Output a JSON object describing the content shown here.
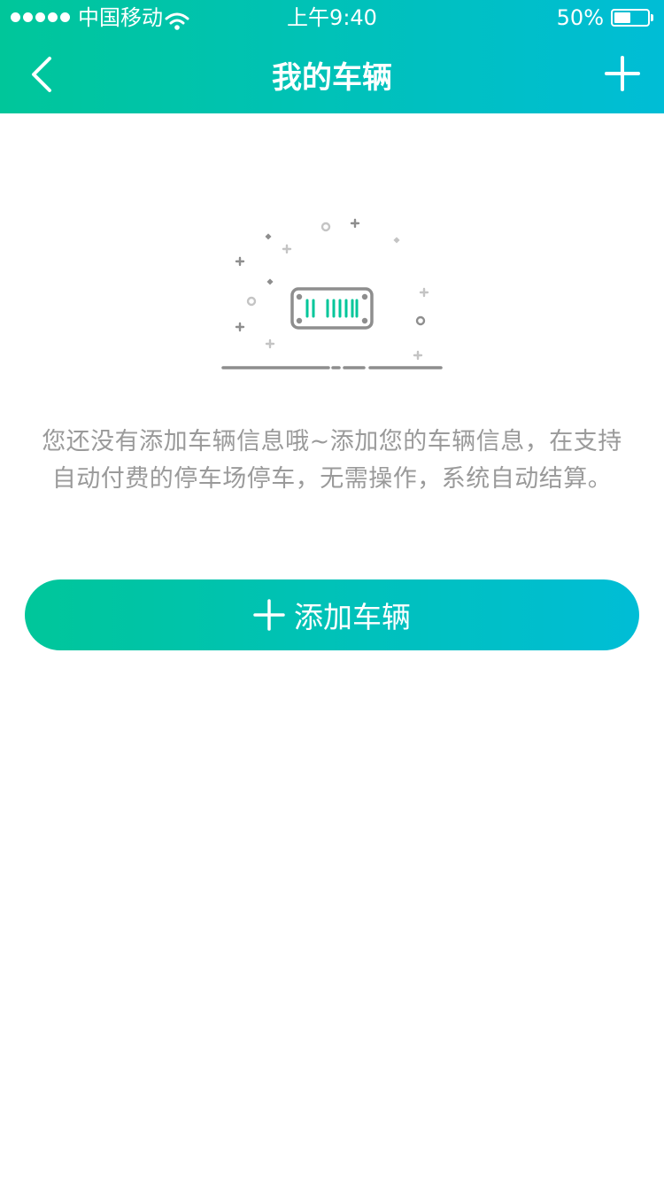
{
  "status_bar": {
    "carrier": "中国移动",
    "time": "上午9:40",
    "battery_percent": "50%",
    "battery_level": 0.5,
    "signal_icon": "signal-dots-icon",
    "wifi_icon": "wifi-icon"
  },
  "nav": {
    "title": "我的车辆",
    "back_icon": "chevron-left-icon",
    "add_icon": "plus-icon"
  },
  "empty_state": {
    "illustration_icon": "license-plate-icon",
    "message_line1": "您还没有添加车辆信息哦~添加您的车辆信息，在支持",
    "message_line2": "自动付费的停车场停车，无需操作，系统自动结算。"
  },
  "add_button": {
    "label": "添加车辆",
    "icon": "plus-icon"
  },
  "colors": {
    "gradient_start": "#00c69a",
    "gradient_end": "#00bdd6",
    "text_muted": "#9a9a9a",
    "illustration_gray": "#8e8e8e",
    "illustration_accent": "#00c69a"
  }
}
